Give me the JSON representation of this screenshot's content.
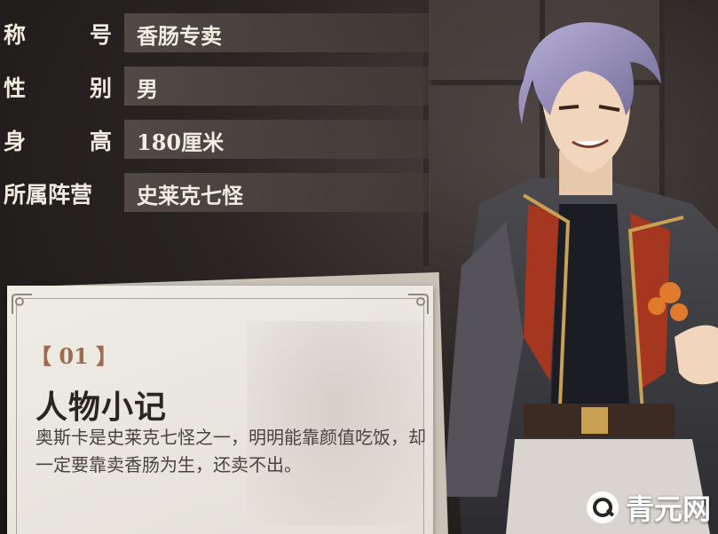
{
  "profile": {
    "rows": [
      {
        "label_chars": [
          "称",
          "号"
        ],
        "value": "香肠专卖"
      },
      {
        "label_chars": [
          "性",
          "别"
        ],
        "value": "男"
      },
      {
        "label_chars": [
          "身",
          "高"
        ],
        "value": "180厘米"
      },
      {
        "label_chars": [
          "所属阵营"
        ],
        "value": "史莱克七怪"
      }
    ]
  },
  "note": {
    "number": "【 01 】",
    "title": "人物小记",
    "body": "奥斯卡是史莱克七怪之一，明明能靠颜值吃饭，却一定要靠卖香肠为生，还卖不出。"
  },
  "watermark": {
    "icon": "search-q-icon",
    "text": "青元网"
  },
  "colors": {
    "label_text": "#f1ebe1",
    "value_box": "#5a504c",
    "card_bg": "#efece6",
    "number_accent": "#9e6b4e"
  }
}
